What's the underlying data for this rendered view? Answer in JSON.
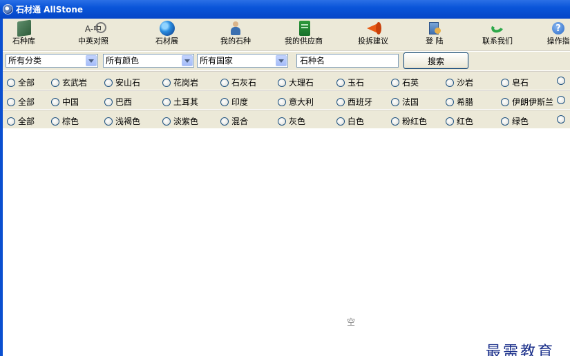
{
  "window": {
    "title": "石材通 AllStone"
  },
  "toolbar": {
    "items": [
      {
        "label": "石种库",
        "icon": "stone-library-icon"
      },
      {
        "label": "中英对照",
        "icon": "dictionary-icon"
      },
      {
        "label": "石材展",
        "icon": "globe-icon"
      },
      {
        "label": "我的石种",
        "icon": "user-icon"
      },
      {
        "label": "我的供应商",
        "icon": "address-book-icon"
      },
      {
        "label": "投拆建议",
        "icon": "megaphone-icon"
      },
      {
        "label": "登 陆",
        "icon": "login-icon"
      },
      {
        "label": "联系我们",
        "icon": "phone-icon"
      },
      {
        "label": "操作指",
        "icon": "help-icon"
      }
    ]
  },
  "filters": {
    "category": "所有分类",
    "color": "所有颜色",
    "country": "所有国家",
    "stone_name": "石种名",
    "search_label": "搜索"
  },
  "radio_rows": {
    "types": [
      "全部",
      "玄武岩",
      "安山石",
      "花岗岩",
      "石灰石",
      "大理石",
      "玉石",
      "石英",
      "沙岩",
      "皂石",
      ""
    ],
    "countries": [
      "全部",
      "中国",
      "巴西",
      "土耳其",
      "印度",
      "意大利",
      "西班牙",
      "法国",
      "希腊",
      "伊朗伊斯兰",
      ""
    ],
    "colors": [
      "全部",
      "棕色",
      "浅褐色",
      "淡紫色",
      "混合",
      "灰色",
      "白色",
      "粉红色",
      "红色",
      "绿色",
      ""
    ]
  },
  "results": {
    "empty_text": "空"
  },
  "watermark": "最需教育"
}
